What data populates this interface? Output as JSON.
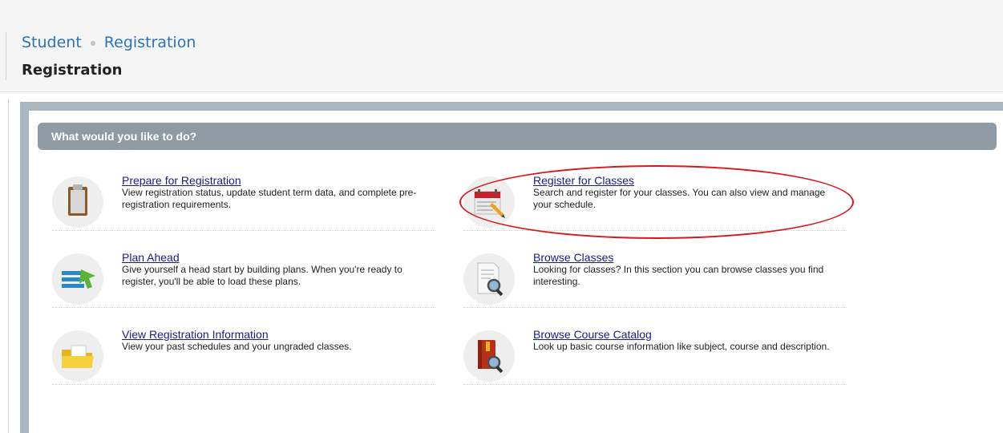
{
  "breadcrumb": {
    "items": [
      "Student",
      "Registration"
    ]
  },
  "page": {
    "title": "Registration"
  },
  "panel": {
    "header": "What would you like to do?"
  },
  "options": [
    {
      "title": "Prepare for Registration",
      "description": "View registration status, update student term data, and complete pre-registration requirements.",
      "icon": "clipboard-icon"
    },
    {
      "title": "Register for Classes",
      "description": "Search and register for your classes. You can also view and manage your schedule.",
      "icon": "calendar-pencil-icon"
    },
    {
      "title": "Plan Ahead",
      "description": "Give yourself a head start by building plans. When you're ready to register, you'll be able to load these plans.",
      "icon": "plan-list-icon"
    },
    {
      "title": "Browse Classes",
      "description": "Looking for classes? In this section you can browse classes you find interesting.",
      "icon": "document-magnifier-icon"
    },
    {
      "title": "View Registration Information",
      "description": "View your past schedules and your ungraded classes.",
      "icon": "folder-icon"
    },
    {
      "title": "Browse Course Catalog",
      "description": "Look up basic course information like subject, course and description.",
      "icon": "book-magnifier-icon"
    }
  ],
  "colors": {
    "link": "#1a1a8c",
    "breadcrumb": "#2a74b8",
    "panel_header_bg": "#8f9aa3",
    "frame": "#aab6c0",
    "highlight": "#d81818"
  }
}
